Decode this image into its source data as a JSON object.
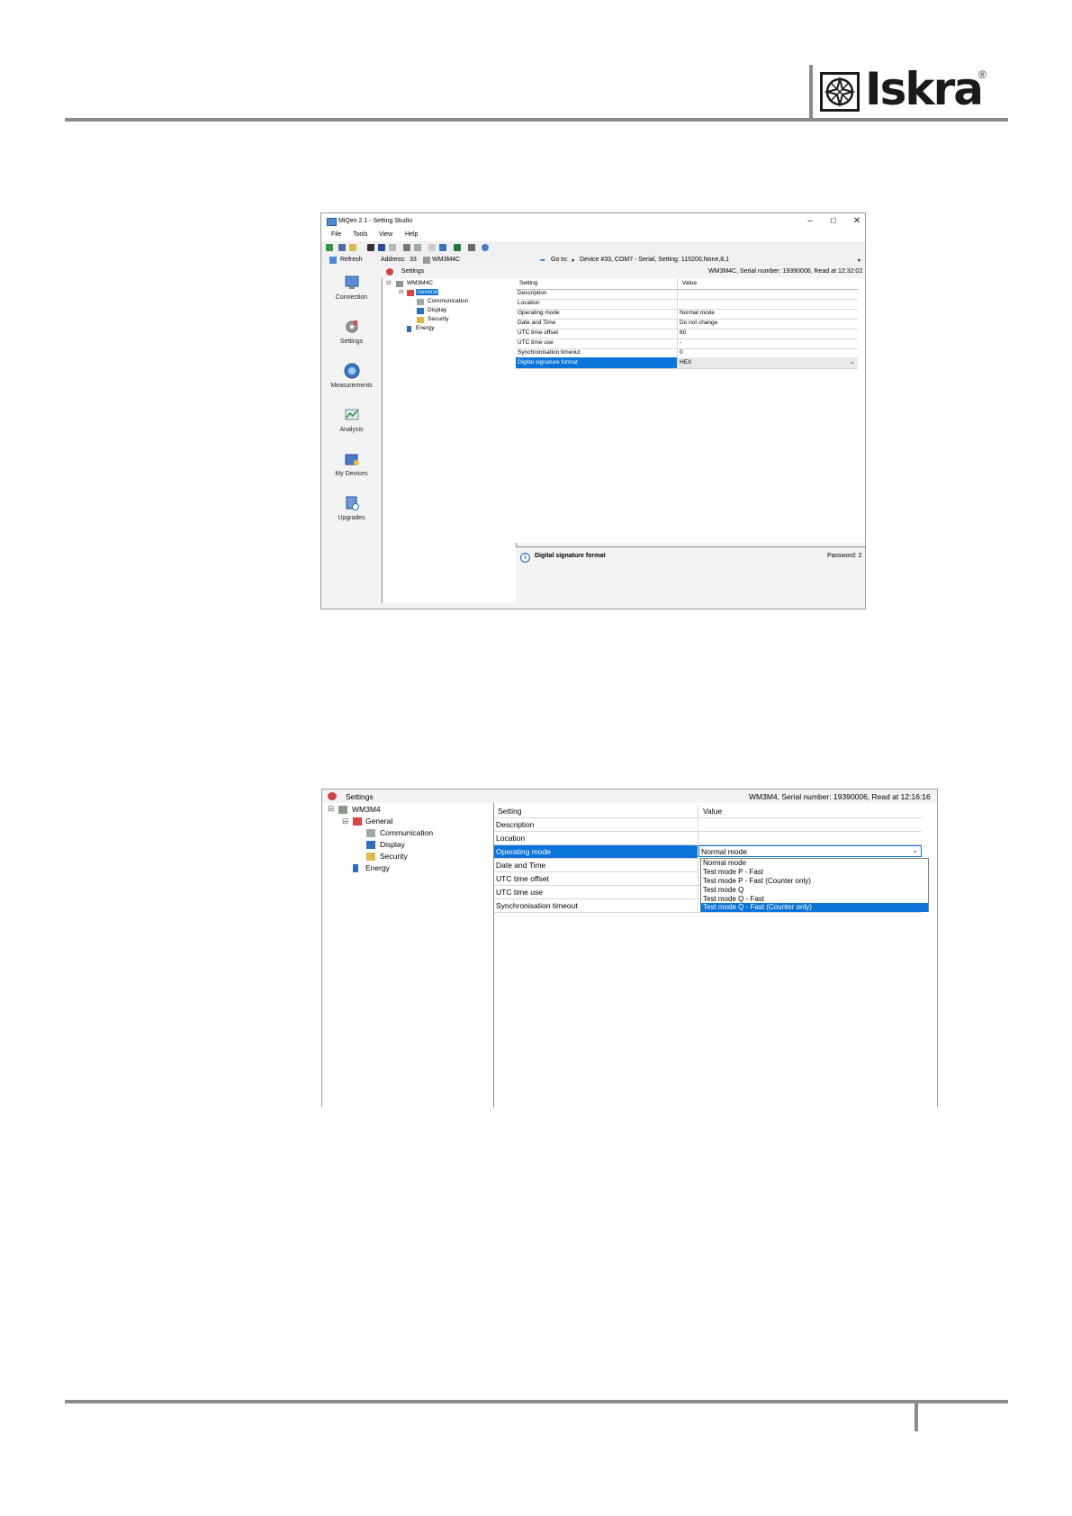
{
  "logo": {
    "text": "Iskra",
    "reg": "®"
  },
  "shot1": {
    "window_title": "MiQen 2.1 - Setting Studio",
    "window_buttons": {
      "minimize": "–",
      "maximize": "☐",
      "close": "✕"
    },
    "menu": [
      "File",
      "Tools",
      "View",
      "Help"
    ],
    "address_bar": {
      "refresh": "Refresh",
      "address_label": "Address:",
      "address_value": "33",
      "device": "WM3M4C",
      "goto": "Go to:",
      "connection": "Device #33, COM7 - Serial, Setting: 115200,None,8,1"
    },
    "nav": [
      "Connection",
      "Settings",
      "Measurements",
      "Analysis",
      "My Devices",
      "Upgrades"
    ],
    "settings_header": {
      "title": "Settings",
      "info": "WM3M4C, Serial number: 19390006, Read at 12:32:02"
    },
    "tree": {
      "root": "WM3M4C",
      "general": "General",
      "communication": "Communication",
      "display": "Display",
      "security": "Security",
      "energy": "Energy"
    },
    "grid": {
      "col_setting": "Setting",
      "col_value": "Value",
      "rows": [
        {
          "setting": "Description",
          "value": ""
        },
        {
          "setting": "Location",
          "value": ""
        },
        {
          "setting": "Operating mode",
          "value": "Normal mode"
        },
        {
          "setting": "Date and Time",
          "value": "Do not change"
        },
        {
          "setting": "UTC time offset",
          "value": "60"
        },
        {
          "setting": "UTC time use",
          "value": "-"
        },
        {
          "setting": "Synchronisation timeout",
          "value": "0"
        },
        {
          "setting": "Digital signature format",
          "value": "HEX"
        }
      ]
    },
    "description": {
      "title": "Digital signature format",
      "password": "Password: 2"
    }
  },
  "shot2": {
    "settings_header": {
      "title": "Settings",
      "info": "WM3M4, Serial number: 19390006, Read at 12:16:16"
    },
    "tree": {
      "root": "WM3M4",
      "general": "General",
      "communication": "Communication",
      "display": "Display",
      "security": "Security",
      "energy": "Energy"
    },
    "grid": {
      "col_setting": "Setting",
      "col_value": "Value",
      "rows": [
        {
          "setting": "Description"
        },
        {
          "setting": "Location"
        },
        {
          "setting": "Operating mode"
        },
        {
          "setting": "Date and Time"
        },
        {
          "setting": "UTC time offset"
        },
        {
          "setting": "UTC time use"
        },
        {
          "setting": "Synchronisation timeout"
        }
      ],
      "operating_mode_value": "Normal mode"
    },
    "dropdown_options": [
      "Normal mode",
      "Test mode P - Fast",
      "Test mode P - Fast (Counter only)",
      "Test mode Q",
      "Test mode Q - Fast",
      "Test mode Q - Fast (Counter only)"
    ]
  }
}
